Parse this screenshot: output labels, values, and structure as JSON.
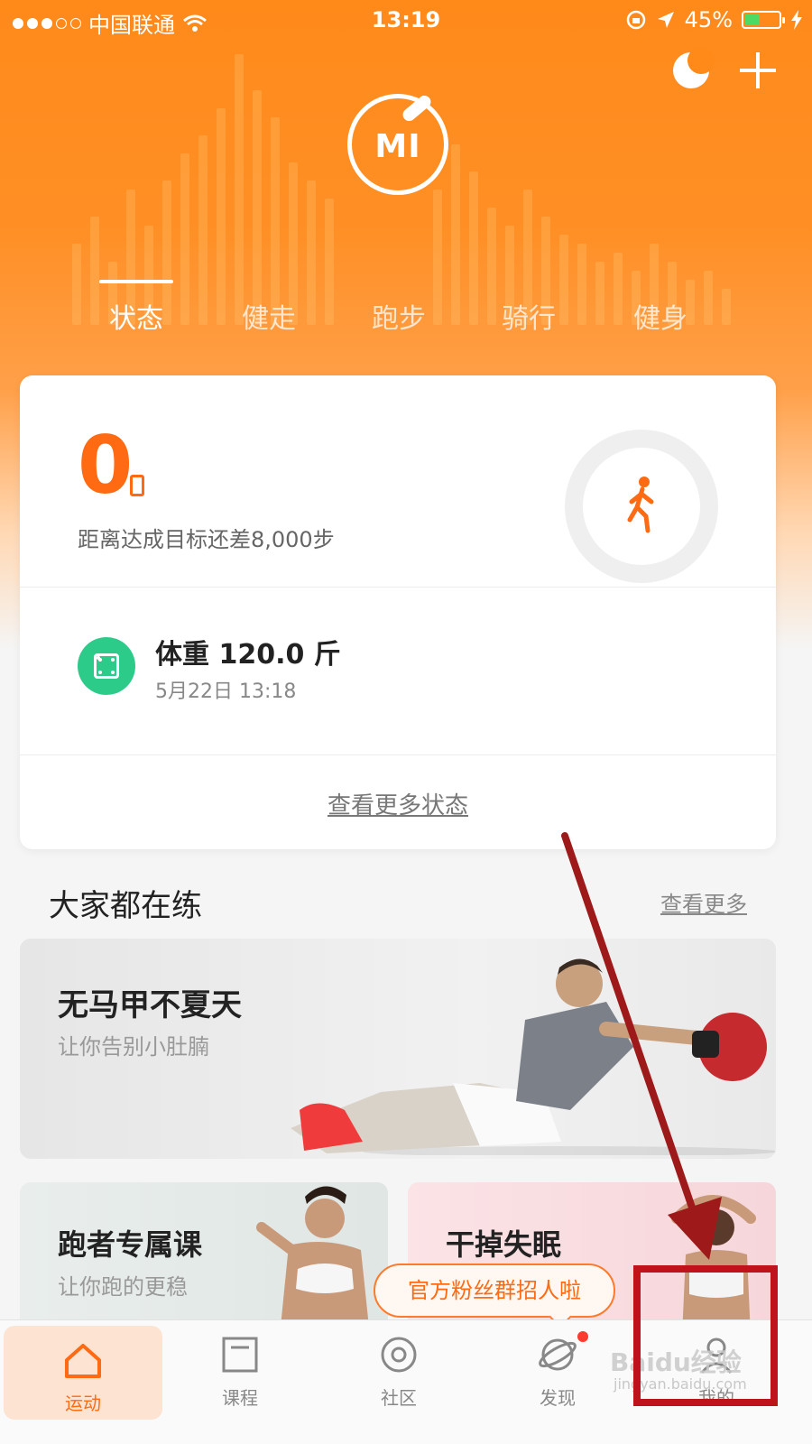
{
  "status_bar": {
    "carrier": "中国联通",
    "time": "13:19",
    "battery": "45%",
    "battery_level": 0.45
  },
  "header": {
    "tabs": [
      {
        "label": "状态",
        "active": true
      },
      {
        "label": "健走",
        "active": false
      },
      {
        "label": "跑步",
        "active": false
      },
      {
        "label": "骑行",
        "active": false
      },
      {
        "label": "健身",
        "active": false
      }
    ],
    "logo_text": "MI"
  },
  "status_card": {
    "steps": "0",
    "goal_text": "距离达成目标还差8,000步",
    "weight_title": "体重 120.0 斤",
    "weight_time": "5月22日 13:18",
    "more_link": "查看更多状态"
  },
  "section": {
    "title": "大家都在练",
    "more": "查看更多"
  },
  "banner": {
    "title": "无马甲不夏天",
    "subtitle": "让你告别小肚腩"
  },
  "tiles": [
    {
      "title": "跑者专属课",
      "subtitle": "让你跑的更稳"
    },
    {
      "title": "干掉失眠",
      "subtitle": ""
    }
  ],
  "toast": "官方粉丝群招人啦",
  "tabbar": [
    {
      "label": "运动",
      "icon": "home-icon",
      "active": true
    },
    {
      "label": "课程",
      "icon": "course-icon",
      "active": false
    },
    {
      "label": "社区",
      "icon": "community-icon",
      "active": false
    },
    {
      "label": "发现",
      "icon": "discover-icon",
      "active": false,
      "badge": true
    },
    {
      "label": "我的",
      "icon": "profile-icon",
      "active": false
    }
  ],
  "watermark": {
    "main": "Baidu经验",
    "sub": "jingyan.baidu.com"
  },
  "colors": {
    "accent": "#ff6a13",
    "header_orange": "#ff8a1a",
    "weight_icon": "#2dcb8a",
    "annotation_red": "#c0121b"
  }
}
